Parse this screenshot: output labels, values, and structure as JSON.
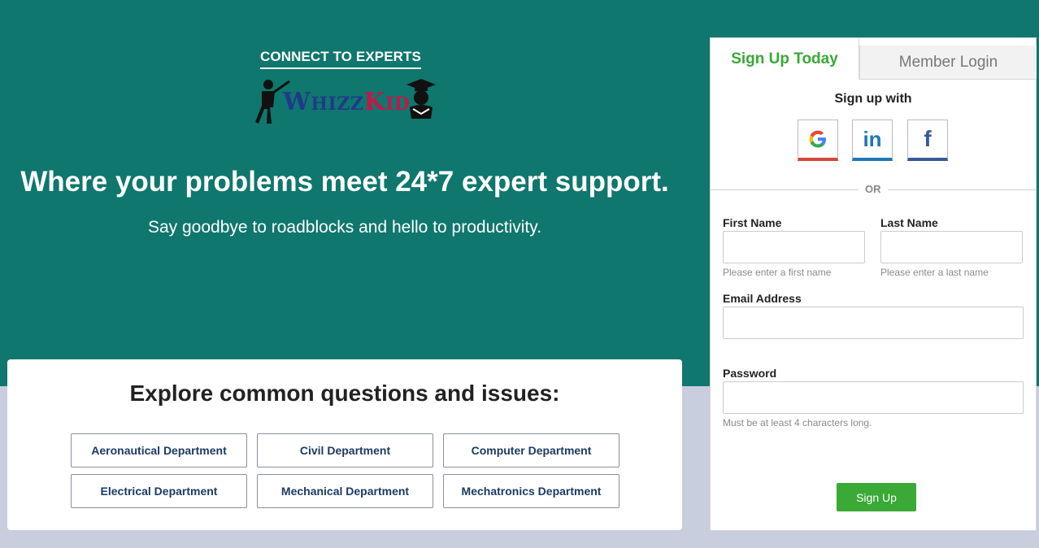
{
  "hero": {
    "tagline": "CONNECT TO EXPERTS",
    "logo_text_1": "W",
    "logo_text_2": "HIZZ",
    "logo_text_3": "K",
    "logo_text_4": "ID",
    "headline": "Where your problems meet 24*7 expert support.",
    "subhead": "Say goodbye to roadblocks and hello to productivity."
  },
  "explore": {
    "title": "Explore common questions and issues:",
    "departments": [
      "Aeronautical Department",
      "Civil Department",
      "Computer Department",
      "Electrical Department",
      "Mechanical Department",
      "Mechatronics Department"
    ]
  },
  "form": {
    "tab_signup": "Sign Up Today",
    "tab_login": "Member Login",
    "signup_with": "Sign up with",
    "social": [
      "google-icon",
      "linkedin-icon",
      "facebook-icon"
    ],
    "or": "OR",
    "first_name_label": "First Name",
    "first_name_value": "",
    "first_name_hint": "Please enter a first name",
    "last_name_label": "Last Name",
    "last_name_value": "",
    "last_name_hint": "Please enter a last name",
    "email_label": "Email Address",
    "email_value": "",
    "password_label": "Password",
    "password_value": "",
    "password_hint": "Must be at least 4 characters long.",
    "submit_label": "Sign Up"
  },
  "colors": {
    "hero_bg": "#0f776d",
    "accent_green": "#3aa935",
    "page_bg": "#c8cedd",
    "google_red": "#d6473a",
    "linkedin_blue": "#1f77b4",
    "facebook_blue": "#3b5998"
  }
}
